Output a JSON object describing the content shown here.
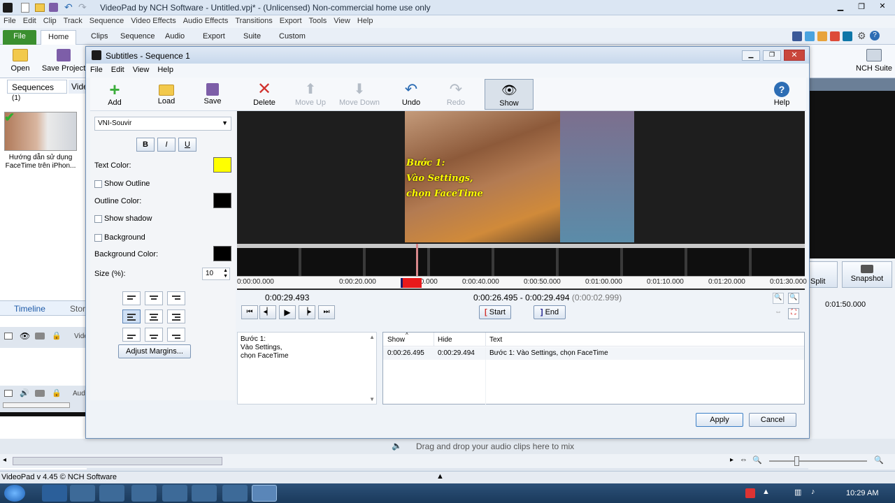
{
  "app": {
    "title": "VideoPad by NCH Software - Untitled.vpj* - (Unlicensed) Non-commercial home use only",
    "menu": [
      "File",
      "Edit",
      "Clip",
      "Track",
      "Sequence",
      "Video Effects",
      "Audio Effects",
      "Transitions",
      "Export",
      "Tools",
      "View",
      "Help"
    ],
    "ribbon_tabs": [
      "File",
      "Home",
      "Clips",
      "Sequence",
      "Audio",
      "Export",
      "Suite",
      "Custom"
    ],
    "ribbon_open": "Open",
    "ribbon_save_project": "Save Project",
    "ribbon_nch_suite": "NCH Suite",
    "ribbon_split": "Split",
    "ribbon_snapshot": "Snapshot",
    "sequences_tab": "Sequences",
    "sequences_count": "(1)",
    "video_tab": "Vide",
    "clip_caption": "Hướng dẫn sử dụng FaceTime trên iPhon...",
    "timeline_tab": "Timeline",
    "storyboard_tab": "Stor",
    "track_video": "Vide",
    "track_audio": "Aud",
    "right_time": "0:01:50.000",
    "drag_drop_hint": "Drag and drop your audio clips here to mix",
    "status": "VideoPad v 4.45 © NCH Software",
    "clock": "10:29 AM"
  },
  "dialog": {
    "title": "Subtitles - Sequence 1",
    "menu": [
      "File",
      "Edit",
      "View",
      "Help"
    ],
    "toolbar": {
      "add": "Add",
      "load": "Load",
      "save": "Save",
      "delete": "Delete",
      "move_up": "Move Up",
      "move_down": "Move Down",
      "undo": "Undo",
      "redo": "Redo",
      "show": "Show",
      "help": "Help"
    },
    "font": "VNI-Souvir",
    "bold": "B",
    "italic": "I",
    "underline": "U",
    "text_color_label": "Text Color:",
    "text_color": "#ffff00",
    "show_outline": "Show Outline",
    "outline_color_label": "Outline Color:",
    "outline_color": "#000000",
    "show_shadow": "Show shadow",
    "background": "Background",
    "background_color_label": "Background Color:",
    "background_color": "#000000",
    "size_label": "Size (%):",
    "size_value": "10",
    "adjust_margins": "Adjust Margins...",
    "preview_caption": [
      "Bước 1:",
      "Vào Settings,",
      "chọn FaceTime"
    ],
    "ruler_ticks": [
      "0:00:00.000",
      "0:00:20.000",
      "0:00:30.000",
      "0:00:40.000",
      "0:00:50.000",
      "0:01:00.000",
      "0:01:10.000",
      "0:01:20.000",
      "0:01:30.000"
    ],
    "current_time": "0:00:29.493",
    "range_start": "0:00:26.495",
    "range_sep": "-",
    "range_end": "0:00:29.494",
    "range_duration": "(0:00:02.999)",
    "start_btn": "Start",
    "end_btn": "End",
    "text_edit": "Bước 1:\nVào Settings,\nchọn FaceTime",
    "table": {
      "headers": [
        "Show",
        "Hide",
        "Text"
      ],
      "rows": [
        {
          "show": "0:00:26.495",
          "hide": "0:00:29.494",
          "text": "Bước 1: Vào Settings, chọn FaceTime"
        }
      ]
    },
    "apply": "Apply",
    "cancel": "Cancel"
  }
}
